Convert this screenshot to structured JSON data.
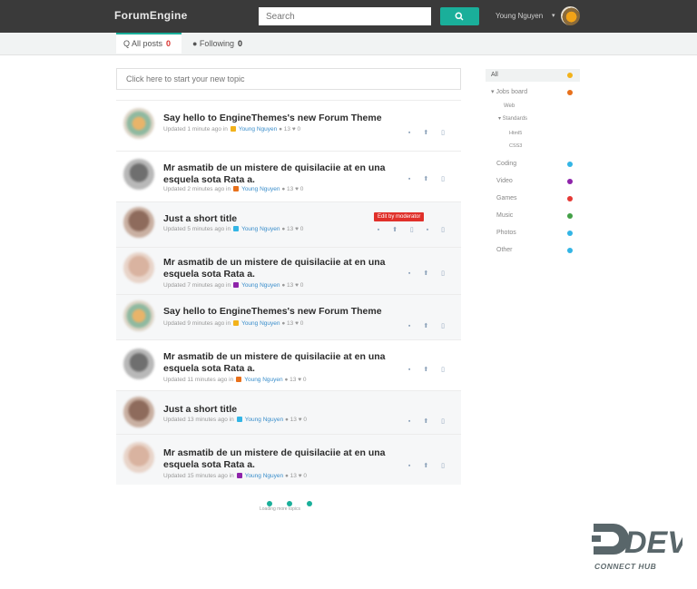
{
  "header": {
    "brand": "ForumEngine",
    "search_placeholder": "Search",
    "user_name": "Young Nguyen",
    "user_caret": "▾",
    "colors": {
      "bar": "#3a3a3a",
      "accent": "#1aaf9a"
    }
  },
  "tabs": [
    {
      "label": "Q All posts",
      "count": "0"
    },
    {
      "label": "● Following",
      "count": "0"
    }
  ],
  "topic_search_placeholder": "Click here to start your new topic",
  "topics": [
    {
      "title": "Say hello to EngineThemes's new Forum Theme",
      "meta_prefix": "Updated 1 minute ago in",
      "category_color": "#f2b21b",
      "author": "Young Nguyen",
      "tail": "● 13 ♥ 0",
      "stats": "▪ ⬆ ▯"
    },
    {
      "title": "Mr asmatib de un mistere de quisilaciie at en una esquela sota Rata a.",
      "meta_prefix": "Updated 2 minutes ago in",
      "category_color": "#e8711c",
      "author": "Young Nguyen",
      "tail": "● 13 ♥ 0",
      "stats": "▪ ⬆ ▯"
    },
    {
      "title": "Just a short title",
      "meta_prefix": "Updated 5 minutes ago in",
      "category_color": "#33b5e5",
      "author": "Young Nguyen",
      "tail": "● 13 ♥ 0",
      "stats": "▪ ⬆ ▯ ▪ ▯",
      "badge": "Edit by moderator"
    },
    {
      "title": "Mr asmatib de un mistere de quisilaciie at en una esquela sota Rata a.",
      "meta_prefix": "Updated 7 minutes ago in",
      "category_color": "#8e24aa",
      "author": "Young Nguyen",
      "tail": "● 13 ♥ 0",
      "stats": "▪ ⬆ ▯"
    },
    {
      "title": "Say hello to EngineThemes's new Forum Theme",
      "meta_prefix": "Updated 9 minutes ago in",
      "category_color": "#f2b21b",
      "author": "Young Nguyen",
      "tail": "● 13 ♥ 0",
      "stats": "▪ ⬆ ▯"
    },
    {
      "title": "Mr asmatib de un mistere de quisilaciie at en una esquela sota Rata a.",
      "meta_prefix": "Updated 11 minutes ago in",
      "category_color": "#e8711c",
      "author": "Young Nguyen",
      "tail": "● 13 ♥ 0",
      "stats": "▪ ⬆ ▯"
    },
    {
      "title": "Just a short title",
      "meta_prefix": "Updated 13 minutes ago in",
      "category_color": "#33b5e5",
      "author": "Young Nguyen",
      "tail": "● 13 ♥ 0",
      "stats": "▪ ⬆ ▯"
    },
    {
      "title": "Mr asmatib de un mistere de quisilaciie at en una esquela sota Rata a.",
      "meta_prefix": "Updated 15 minutes ago in",
      "category_color": "#8e24aa",
      "author": "Young Nguyen",
      "tail": "● 13 ♥ 0",
      "stats": "▪ ⬆ ▯"
    }
  ],
  "pager_text": "Loading more topics",
  "sidebar": [
    {
      "label": "All",
      "color": "#f2b21b"
    },
    {
      "label": "▾ Jobs board",
      "color": "#e8711c"
    },
    {
      "label": "Web",
      "color": ""
    },
    {
      "label": "▾ Standards",
      "color": ""
    },
    {
      "label": "Html5",
      "color": ""
    },
    {
      "label": "CSS3",
      "color": ""
    },
    {
      "label": "Coding",
      "color": "#33b5e5"
    },
    {
      "label": "Video",
      "color": "#8e24aa"
    },
    {
      "label": "Games",
      "color": "#e53935"
    },
    {
      "label": "Music",
      "color": "#43a047"
    },
    {
      "label": "Photos",
      "color": "#33b5e5"
    },
    {
      "label": "Other",
      "color": "#33b5e5"
    }
  ],
  "watermark": {
    "brand": "DEV",
    "tagline": "CONNECT HUB"
  }
}
